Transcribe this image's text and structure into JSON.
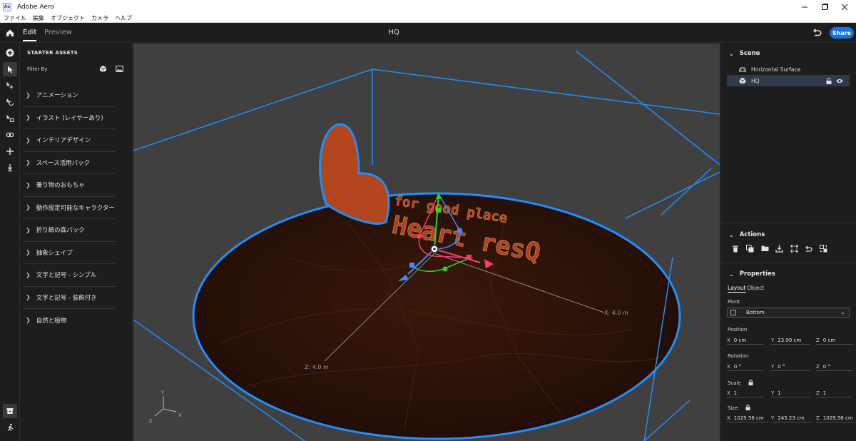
{
  "window": {
    "app_icon_text": "Ae",
    "title": "Adobe Aero",
    "controls": [
      "minimize",
      "maximize",
      "close"
    ]
  },
  "menu": [
    "ファイル",
    "編集",
    "オブジェクト",
    "カメラ",
    "ヘルプ"
  ],
  "header": {
    "tabs": {
      "edit": "Edit",
      "preview": "Preview"
    },
    "document_title": "HQ",
    "share_label": "Share"
  },
  "assets": {
    "heading": "STARTER ASSETS",
    "filter_label": "Filter By",
    "categories": [
      "アニメーション",
      "イラスト (レイヤーあり)",
      "インテリアデザイン",
      "スペース活用パック",
      "乗り物のおもちゃ",
      "動作設定可能なキャラクター",
      "折り紙の森パック",
      "抽象シェイプ",
      "文字と記号 - シンプル",
      "文字と記号 - 装飾付き",
      "自然と植物"
    ]
  },
  "viewport": {
    "model_text_small": "for good place",
    "model_text_large": "Heart resQ",
    "x_axis_label": "X:  4.0 m",
    "z_axis_label": "Z:  4.0 m",
    "gizmo_y": "Y",
    "gizmo_x": "X",
    "gizmo_z": "Z",
    "colors": {
      "selection": "#1e8fff",
      "ground": "#2e1408",
      "model": "#b3461c"
    }
  },
  "scene": {
    "title": "Scene",
    "items": [
      "Horizontal Surface",
      "HQ"
    ]
  },
  "actions": {
    "title": "Actions"
  },
  "properties": {
    "title": "Properties",
    "tabs": {
      "layout": "Layout",
      "object": "Object"
    },
    "pivot_label": "Pivot",
    "pivot_value": "Bottom",
    "position_label": "Position",
    "position": {
      "x": "0 cm",
      "y": "23.99 cm",
      "z": "0 cm"
    },
    "rotation_label": "Rotation",
    "rotation": {
      "x": "0 °",
      "y": "0 °",
      "z": "0 °"
    },
    "scale_label": "Scale",
    "scale": {
      "x": "1",
      "y": "1",
      "z": "1"
    },
    "size_label": "Size",
    "size": {
      "x": "1029.56 cm",
      "y": "245.23 cm",
      "z": "1029.56 cm"
    },
    "axis_letters": {
      "x": "X",
      "y": "Y",
      "z": "Z"
    }
  }
}
